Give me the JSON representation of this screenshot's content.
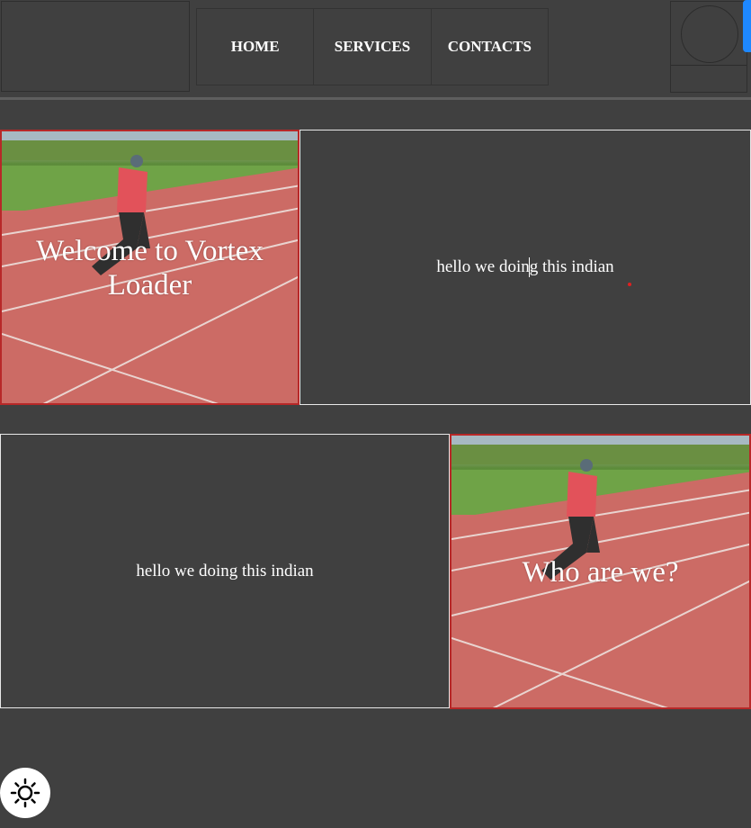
{
  "nav": {
    "items": [
      {
        "label": "HOME"
      },
      {
        "label": "SERVICES"
      },
      {
        "label": "CONTACTS"
      }
    ]
  },
  "sections": [
    {
      "image_caption": "Welcome to Vortex Loader",
      "text": "hello we doing this indian"
    },
    {
      "image_caption": "Who are we?",
      "text": "hello we doing this indian"
    }
  ],
  "icons": {
    "theme_toggle": "sun-icon"
  },
  "colors": {
    "background": "#404040",
    "accent_border": "#b72828",
    "blue_tab": "#1e88ff"
  }
}
